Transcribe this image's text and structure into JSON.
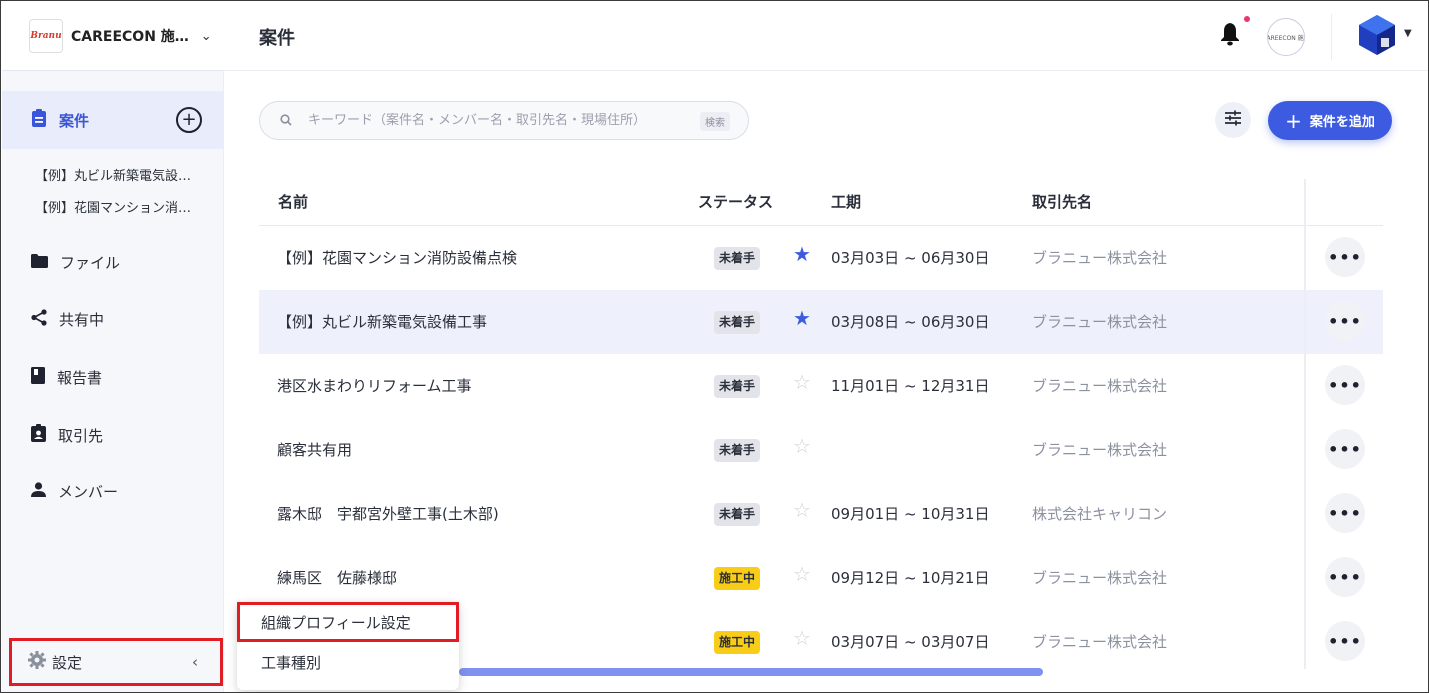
{
  "org": {
    "logo_text": "Branu",
    "name": "CAREECON 施…"
  },
  "sidebar": {
    "active": {
      "label": "案件"
    },
    "recent": [
      "【例】丸ビル新築電気設…",
      "【例】花園マンション消…"
    ],
    "items": [
      {
        "label": "ファイル",
        "icon": "folder-icon"
      },
      {
        "label": "共有中",
        "icon": "share-icon"
      },
      {
        "label": "報告書",
        "icon": "report-icon"
      },
      {
        "label": "取引先",
        "icon": "client-badge-icon"
      },
      {
        "label": "メンバー",
        "icon": "person-icon"
      }
    ],
    "settings": {
      "label": "設定"
    }
  },
  "header": {
    "title": "案件",
    "org_avatar_text": "CAREECON 施工"
  },
  "toolbar": {
    "search_placeholder": "キーワード（案件名・メンバー名・取引先名・現場住所）",
    "search_hint": "検索",
    "add_label": "案件を追加"
  },
  "table": {
    "headers": {
      "name": "名前",
      "status": "ステータス",
      "period": "工期",
      "client": "取引先名"
    },
    "rows": [
      {
        "name": "【例】花園マンション消防設備点検",
        "status": "未着手",
        "status_kind": "todo",
        "starred": true,
        "period": "03月03日 ~ 06月30日",
        "client": "ブラニュー株式会社",
        "highlight": false
      },
      {
        "name": "【例】丸ビル新築電気設備工事",
        "status": "未着手",
        "status_kind": "todo",
        "starred": true,
        "period": "03月08日 ~ 06月30日",
        "client": "ブラニュー株式会社",
        "highlight": true
      },
      {
        "name": "港区水まわりリフォーム工事",
        "status": "未着手",
        "status_kind": "todo",
        "starred": false,
        "period": "11月01日 ~ 12月31日",
        "client": "ブラニュー株式会社",
        "highlight": false
      },
      {
        "name": "顧客共有用",
        "status": "未着手",
        "status_kind": "todo",
        "starred": false,
        "period": "",
        "client": "ブラニュー株式会社",
        "highlight": false
      },
      {
        "name": "露木邸　宇都宮外壁工事(土木部)",
        "status": "未着手",
        "status_kind": "todo",
        "starred": false,
        "period": "09月01日 ~ 10月31日",
        "client": "株式会社キャリコン",
        "highlight": false
      },
      {
        "name": "練馬区　佐藤様邸",
        "status": "施工中",
        "status_kind": "wip",
        "starred": false,
        "period": "09月12日 ~ 10月21日",
        "client": "ブラニュー株式会社",
        "highlight": false
      },
      {
        "name": "",
        "status": "施工中",
        "status_kind": "wip",
        "starred": false,
        "period": "03月07日 ~ 03月07日",
        "client": "ブラニュー株式会社",
        "highlight": false
      }
    ],
    "more_label": "•••"
  },
  "popup_menu": {
    "items": [
      "組織プロフィール設定",
      "工事種別"
    ]
  },
  "colors": {
    "accent": "#3d5be0",
    "highlight_row": "#eef1fb",
    "status_todo": "#e3e4ea",
    "status_wip": "#f9cc17",
    "annotation_red": "#e21c24"
  }
}
